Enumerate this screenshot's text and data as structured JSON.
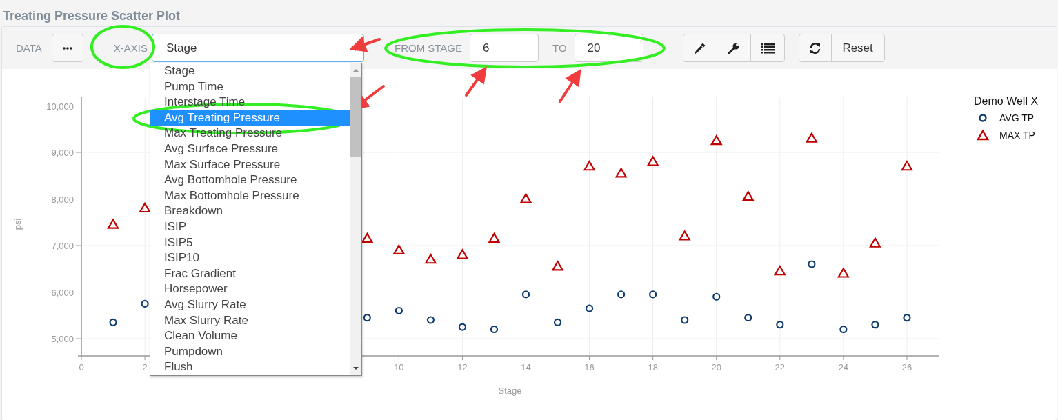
{
  "title": "Treating Pressure Scatter Plot",
  "toolbar": {
    "data_label": "DATA",
    "x_axis_label": "X-AXIS",
    "x_axis_value": "Stage",
    "from_label": "FROM STAGE",
    "from": "6",
    "to_label": "TO",
    "to": "20",
    "reset": "Reset"
  },
  "dropdown": {
    "options": [
      {
        "label": "Stage",
        "selected": false
      },
      {
        "label": "Pump Time",
        "selected": false
      },
      {
        "label": "Interstage Time",
        "selected": false
      },
      {
        "label": "Avg Treating Pressure",
        "selected": true
      },
      {
        "label": "Max Treating Pressure",
        "selected": false
      },
      {
        "label": "Avg Surface Pressure",
        "selected": false
      },
      {
        "label": "Max Surface Pressure",
        "selected": false
      },
      {
        "label": "Avg Bottomhole Pressure",
        "selected": false
      },
      {
        "label": "Max Bottomhole Pressure",
        "selected": false
      },
      {
        "label": "Breakdown",
        "selected": false
      },
      {
        "label": "ISIP",
        "selected": false
      },
      {
        "label": "ISIP5",
        "selected": false
      },
      {
        "label": "ISIP10",
        "selected": false
      },
      {
        "label": "Frac Gradient",
        "selected": false
      },
      {
        "label": "Horsepower",
        "selected": false
      },
      {
        "label": "Avg Slurry Rate",
        "selected": false
      },
      {
        "label": "Max Slurry Rate",
        "selected": false
      },
      {
        "label": "Clean Volume",
        "selected": false
      },
      {
        "label": "Pumpdown",
        "selected": false
      },
      {
        "label": "Flush",
        "selected": false
      }
    ]
  },
  "chart": {
    "chart_data": {
      "type": "scatter",
      "xlabel": "Stage",
      "ylabel": "psi",
      "grid": true,
      "legend": {
        "title": "Demo Well X"
      },
      "x": [
        1,
        2,
        9,
        10,
        11,
        12,
        13,
        14,
        15,
        16,
        17,
        18,
        19,
        20,
        21,
        22,
        23,
        24,
        25,
        26
      ],
      "series": [
        {
          "name": "AVG TP",
          "color": "#0d3b6e",
          "values": [
            5350,
            5750,
            5450,
            5600,
            5400,
            5250,
            5200,
            5950,
            5350,
            5650,
            5950,
            5950,
            5400,
            5900,
            5450,
            5300,
            6600,
            5200,
            5300,
            5450
          ]
        },
        {
          "name": "MAX TP",
          "color": "#c00000",
          "values": [
            7450,
            7800,
            7150,
            6900,
            6700,
            6800,
            7150,
            8000,
            6550,
            8700,
            8550,
            8800,
            7200,
            9250,
            8050,
            6450,
            9300,
            6400,
            7050,
            8700
          ]
        }
      ],
      "xlim": [
        0,
        27
      ],
      "ylim": [
        4630,
        10200
      ],
      "xticks": [
        0,
        2,
        10,
        12,
        14,
        16,
        18,
        20,
        22,
        24,
        26
      ],
      "yticks": [
        {
          "value": 5000,
          "label": "5,000"
        },
        {
          "value": 6000,
          "label": "6,000"
        },
        {
          "value": 7000,
          "label": "7,000"
        },
        {
          "value": 8000,
          "label": "8,000"
        },
        {
          "value": 9000,
          "label": "9,000"
        },
        {
          "value": 10000,
          "label": "10,000"
        }
      ]
    }
  }
}
